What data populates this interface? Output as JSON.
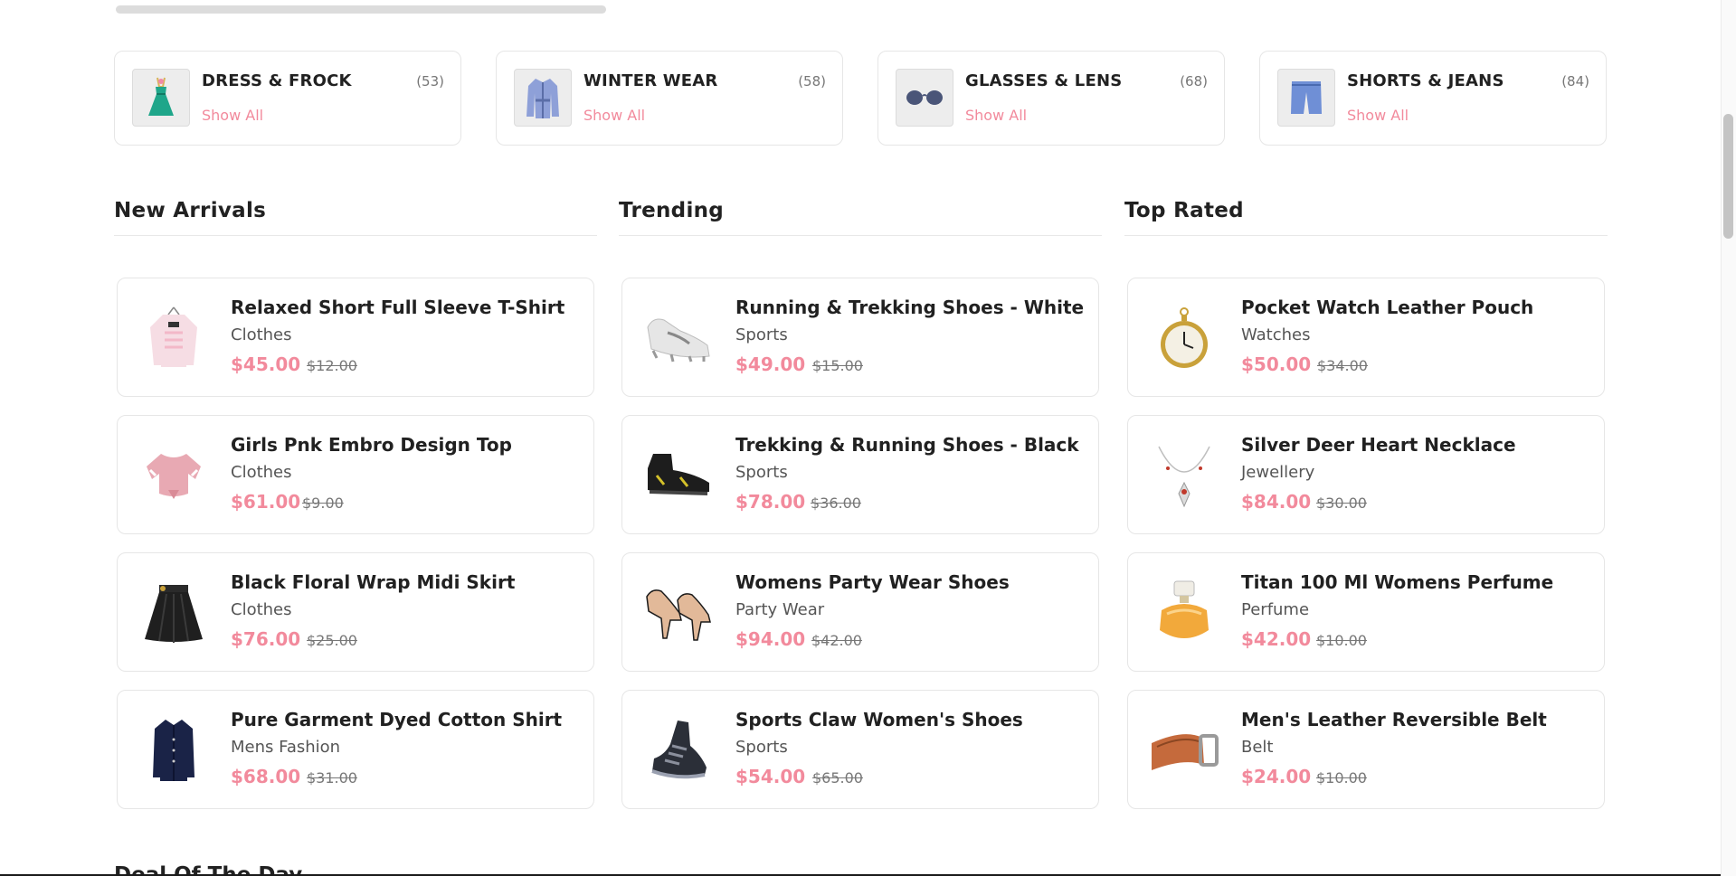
{
  "categories": [
    {
      "title": "DRESS & FROCK",
      "count": "(53)",
      "link": "Show All",
      "icon": "dress-icon"
    },
    {
      "title": "WINTER WEAR",
      "count": "(58)",
      "link": "Show All",
      "icon": "coat-icon"
    },
    {
      "title": "GLASSES & LENS",
      "count": "(68)",
      "link": "Show All",
      "icon": "glasses-icon"
    },
    {
      "title": "SHORTS & JEANS",
      "count": "(84)",
      "link": "Show All",
      "icon": "shorts-icon"
    }
  ],
  "sections": [
    {
      "title": "New Arrivals",
      "products": [
        {
          "title": "Relaxed Short Full Sleeve T-Shirt",
          "category": "Clothes",
          "price": "$45.00",
          "old_price": "$12.00",
          "icon": "sweatshirt-icon"
        },
        {
          "title": "Girls Pnk Embro Design Top",
          "category": "Clothes",
          "price": "$61.00",
          "old_price": "$9.00",
          "icon": "pink-top-icon"
        },
        {
          "title": "Black Floral Wrap Midi Skirt",
          "category": "Clothes",
          "price": "$76.00",
          "old_price": "$25.00",
          "icon": "skirt-icon"
        },
        {
          "title": "Pure Garment Dyed Cotton Shirt",
          "category": "Mens Fashion",
          "price": "$68.00",
          "old_price": "$31.00",
          "icon": "shirt-icon"
        }
      ]
    },
    {
      "title": "Trending",
      "products": [
        {
          "title": "Running & Trekking Shoes - White",
          "category": "Sports",
          "price": "$49.00",
          "old_price": "$15.00",
          "icon": "white-shoe-icon"
        },
        {
          "title": "Trekking & Running Shoes - Black",
          "category": "Sports",
          "price": "$78.00",
          "old_price": "$36.00",
          "icon": "black-shoe-icon"
        },
        {
          "title": "Womens Party Wear Shoes",
          "category": "Party Wear",
          "price": "$94.00",
          "old_price": "$42.00",
          "icon": "heels-icon"
        },
        {
          "title": "Sports Claw Women's Shoes",
          "category": "Sports",
          "price": "$54.00",
          "old_price": "$65.00",
          "icon": "sneaker-icon"
        }
      ]
    },
    {
      "title": "Top Rated",
      "products": [
        {
          "title": "Pocket Watch Leather Pouch",
          "category": "Watches",
          "price": "$50.00",
          "old_price": "$34.00",
          "icon": "pocket-watch-icon"
        },
        {
          "title": "Silver Deer Heart Necklace",
          "category": "Jewellery",
          "price": "$84.00",
          "old_price": "$30.00",
          "icon": "necklace-icon"
        },
        {
          "title": "Titan 100 Ml Womens Perfume",
          "category": "Perfume",
          "price": "$42.00",
          "old_price": "$10.00",
          "icon": "perfume-icon"
        },
        {
          "title": "Men's Leather Reversible Belt",
          "category": "Belt",
          "price": "$24.00",
          "old_price": "$10.00",
          "icon": "belt-icon"
        }
      ]
    }
  ],
  "next_section_title": "Deal Of The Day",
  "colors": {
    "accent": "#f28a9c",
    "text": "#212121",
    "muted": "#777777",
    "border": "#e6e6e6"
  }
}
